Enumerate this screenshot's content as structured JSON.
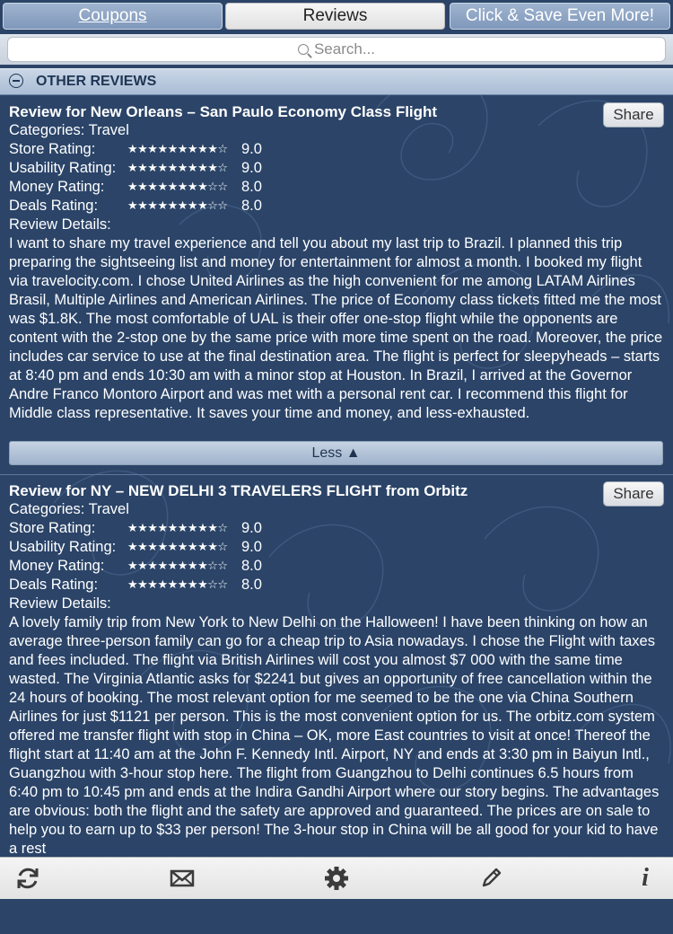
{
  "tabs": {
    "coupons": "Coupons",
    "reviews": "Reviews",
    "promo": "Click & Save Even More!"
  },
  "search": {
    "placeholder": "Search..."
  },
  "section": {
    "title": "OTHER REVIEWS"
  },
  "reviews": [
    {
      "title": "Review for New Orleans – San Paulo Economy Class Flight",
      "categories": "Categories: Travel",
      "share": "Share",
      "ratings": [
        {
          "label": "Store Rating:",
          "stars": "★★★★★★★★★☆",
          "value": "9.0"
        },
        {
          "label": "Usability Rating:",
          "stars": "★★★★★★★★★☆",
          "value": "9.0"
        },
        {
          "label": "Money Rating:",
          "stars": "★★★★★★★★☆☆",
          "value": "8.0"
        },
        {
          "label": "Deals Rating:",
          "stars": "★★★★★★★★☆☆",
          "value": "8.0"
        }
      ],
      "details_label": "Review Details:",
      "details": "I want to share my travel experience and tell you about my last trip to Brazil. I planned this trip preparing the sightseeing list and money for entertainment for almost a month. I booked my flight via travelocity.com. I chose United Airlines as the high convenient for me among LATAM Airlines Brasil, Multiple Airlines and American Airlines. The price of Economy class tickets fitted me the most was $1.8K. The most comfortable of UAL is their offer one-stop flight while the opponents are content with the 2-stop one by the same price with more time spent on the road. Moreover, the price includes car service to use at the final destination area. The flight is perfect for sleepyheads – starts at 8:40 pm and ends 10:30 am with a minor stop at Houston. In Brazil, I arrived at the Governor Andre Franco Montoro Airport and was met with a personal rent car. I recommend this flight for Middle class representative. It saves your time and money, and less-exhausted.",
      "less": "Less ▲"
    },
    {
      "title": "Review for NY – NEW DELHI 3 TRAVELERS FLIGHT from Orbitz",
      "categories": "Categories: Travel",
      "share": "Share",
      "ratings": [
        {
          "label": "Store Rating:",
          "stars": "★★★★★★★★★☆",
          "value": "9.0"
        },
        {
          "label": "Usability Rating:",
          "stars": "★★★★★★★★★☆",
          "value": "9.0"
        },
        {
          "label": "Money Rating:",
          "stars": "★★★★★★★★☆☆",
          "value": "8.0"
        },
        {
          "label": "Deals Rating:",
          "stars": "★★★★★★★★☆☆",
          "value": "8.0"
        }
      ],
      "details_label": "Review Details:",
      "details": "A lovely family trip from New York to New Delhi on the Halloween! I have been thinking on how an average three-person family can go for a cheap trip to Asia nowadays. I chose the Flight with taxes and fees included. The flight via British Airlines will cost you almost $7 000 with the same time wasted. The Virginia Atlantic asks for $2241 but gives an opportunity of free cancellation within the 24 hours of booking. The most relevant option for me seemed to be the one via China Southern Airlines for just $1121 per person. This is the most convenient option for us. The orbitz.com system offered me transfer flight with stop in China – OK, more East countries to visit at once! Thereof the flight start at 11:40 am at the John F. Kennedy Intl. Airport, NY and ends at 3:30 pm in Baiyun Intl., Guangzhou with 3-hour stop here. The flight from Guangzhou to Delhi continues 6.5 hours from 6:40 pm to 10:45 pm and ends at the Indira Gandhi Airport where our story begins. The advantages are obvious: both the flight and the safety are approved and guaranteed. The prices are on sale to help you to earn up to $33 per person! The 3-hour stop in China will be all good for your kid to have a rest"
    }
  ],
  "toolbar": {
    "icons": [
      "refresh-icon",
      "mail-icon",
      "gear-icon",
      "pencil-icon",
      "info-icon"
    ],
    "info_glyph": "i"
  }
}
